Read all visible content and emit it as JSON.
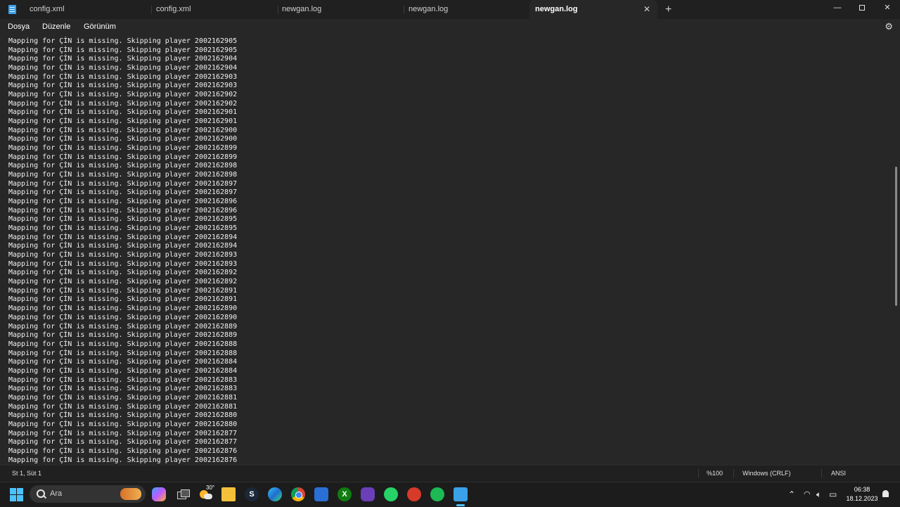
{
  "window": {
    "tabs": [
      {
        "label": "config.xml",
        "active": false
      },
      {
        "label": "config.xml",
        "active": false
      },
      {
        "label": "newgan.log",
        "active": false
      },
      {
        "label": "newgan.log",
        "active": false
      },
      {
        "label": "newgan.log",
        "active": true
      }
    ],
    "close_tab_glyph": "✕",
    "new_tab_glyph": "+",
    "minimize_glyph": "—",
    "close_glyph": "✕"
  },
  "menu": {
    "items": [
      "Dosya",
      "Düzenle",
      "Görünüm"
    ],
    "settings_icon": "gear-icon"
  },
  "editor": {
    "lines": [
      "Mapping for ÇİN is missing. Skipping player 2002162905",
      "Mapping for ÇİN is missing. Skipping player 2002162905",
      "Mapping for ÇİN is missing. Skipping player 2002162904",
      "Mapping for ÇİN is missing. Skipping player 2002162904",
      "Mapping for ÇİN is missing. Skipping player 2002162903",
      "Mapping for ÇİN is missing. Skipping player 2002162903",
      "Mapping for ÇİN is missing. Skipping player 2002162902",
      "Mapping for ÇİN is missing. Skipping player 2002162902",
      "Mapping for ÇİN is missing. Skipping player 2002162901",
      "Mapping for ÇİN is missing. Skipping player 2002162901",
      "Mapping for ÇİN is missing. Skipping player 2002162900",
      "Mapping for ÇİN is missing. Skipping player 2002162900",
      "Mapping for ÇİN is missing. Skipping player 2002162899",
      "Mapping for ÇİN is missing. Skipping player 2002162899",
      "Mapping for ÇİN is missing. Skipping player 2002162898",
      "Mapping for ÇİN is missing. Skipping player 2002162898",
      "Mapping for ÇİN is missing. Skipping player 2002162897",
      "Mapping for ÇİN is missing. Skipping player 2002162897",
      "Mapping for ÇİN is missing. Skipping player 2002162896",
      "Mapping for ÇİN is missing. Skipping player 2002162896",
      "Mapping for ÇİN is missing. Skipping player 2002162895",
      "Mapping for ÇİN is missing. Skipping player 2002162895",
      "Mapping for ÇİN is missing. Skipping player 2002162894",
      "Mapping for ÇİN is missing. Skipping player 2002162894",
      "Mapping for ÇİN is missing. Skipping player 2002162893",
      "Mapping for ÇİN is missing. Skipping player 2002162893",
      "Mapping for ÇİN is missing. Skipping player 2002162892",
      "Mapping for ÇİN is missing. Skipping player 2002162892",
      "Mapping for ÇİN is missing. Skipping player 2002162891",
      "Mapping for ÇİN is missing. Skipping player 2002162891",
      "Mapping for ÇİN is missing. Skipping player 2002162890",
      "Mapping for ÇİN is missing. Skipping player 2002162890",
      "Mapping for ÇİN is missing. Skipping player 2002162889",
      "Mapping for ÇİN is missing. Skipping player 2002162889",
      "Mapping for ÇİN is missing. Skipping player 2002162888",
      "Mapping for ÇİN is missing. Skipping player 2002162888",
      "Mapping for ÇİN is missing. Skipping player 2002162884",
      "Mapping for ÇİN is missing. Skipping player 2002162884",
      "Mapping for ÇİN is missing. Skipping player 2002162883",
      "Mapping for ÇİN is missing. Skipping player 2002162883",
      "Mapping for ÇİN is missing. Skipping player 2002162881",
      "Mapping for ÇİN is missing. Skipping player 2002162881",
      "Mapping for ÇİN is missing. Skipping player 2002162880",
      "Mapping for ÇİN is missing. Skipping player 2002162880",
      "Mapping for ÇİN is missing. Skipping player 2002162877",
      "Mapping for ÇİN is missing. Skipping player 2002162877",
      "Mapping for ÇİN is missing. Skipping player 2002162876",
      "Mapping for ÇİN is missing. Skipping player 2002162876"
    ]
  },
  "statusbar": {
    "position": "St 1, Süt 1",
    "zoom": "%100",
    "line_ending": "Windows (CRLF)",
    "encoding": "ANSI"
  },
  "taskbar": {
    "search_placeholder": "Ara",
    "weather_temp": "30°",
    "clock_time": "06:38",
    "clock_date": "18.12.2023",
    "accent_color": "#4cc2ff",
    "apps": [
      "copilot-icon",
      "task-view-icon",
      "weather-icon",
      "file-explorer-icon",
      "steam-icon",
      "edge-icon",
      "chrome-icon",
      "store-icon",
      "xbox-icon",
      "clipchamp-icon",
      "whatsapp-icon",
      "game-icon",
      "spotify-icon",
      "notepad-icon"
    ]
  }
}
